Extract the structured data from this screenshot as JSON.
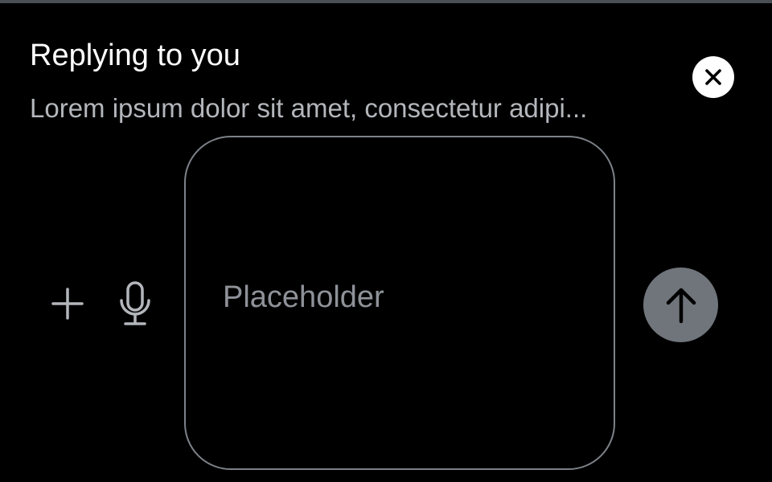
{
  "reply": {
    "title": "Replying to you",
    "preview": "Lorem ipsum dolor sit amet, consectetur adipi..."
  },
  "composer": {
    "placeholder": "Placeholder",
    "value": ""
  },
  "icons": {
    "close": "close-icon",
    "add": "plus-icon",
    "voice": "microphone-icon",
    "send": "arrow-up-icon"
  },
  "colors": {
    "background": "#000000",
    "close_button": "#ffffff",
    "send_button": "#70757c",
    "input_border": "#7d8289",
    "secondary_text": "#b3b6bb",
    "placeholder_text": "#8e9298"
  }
}
